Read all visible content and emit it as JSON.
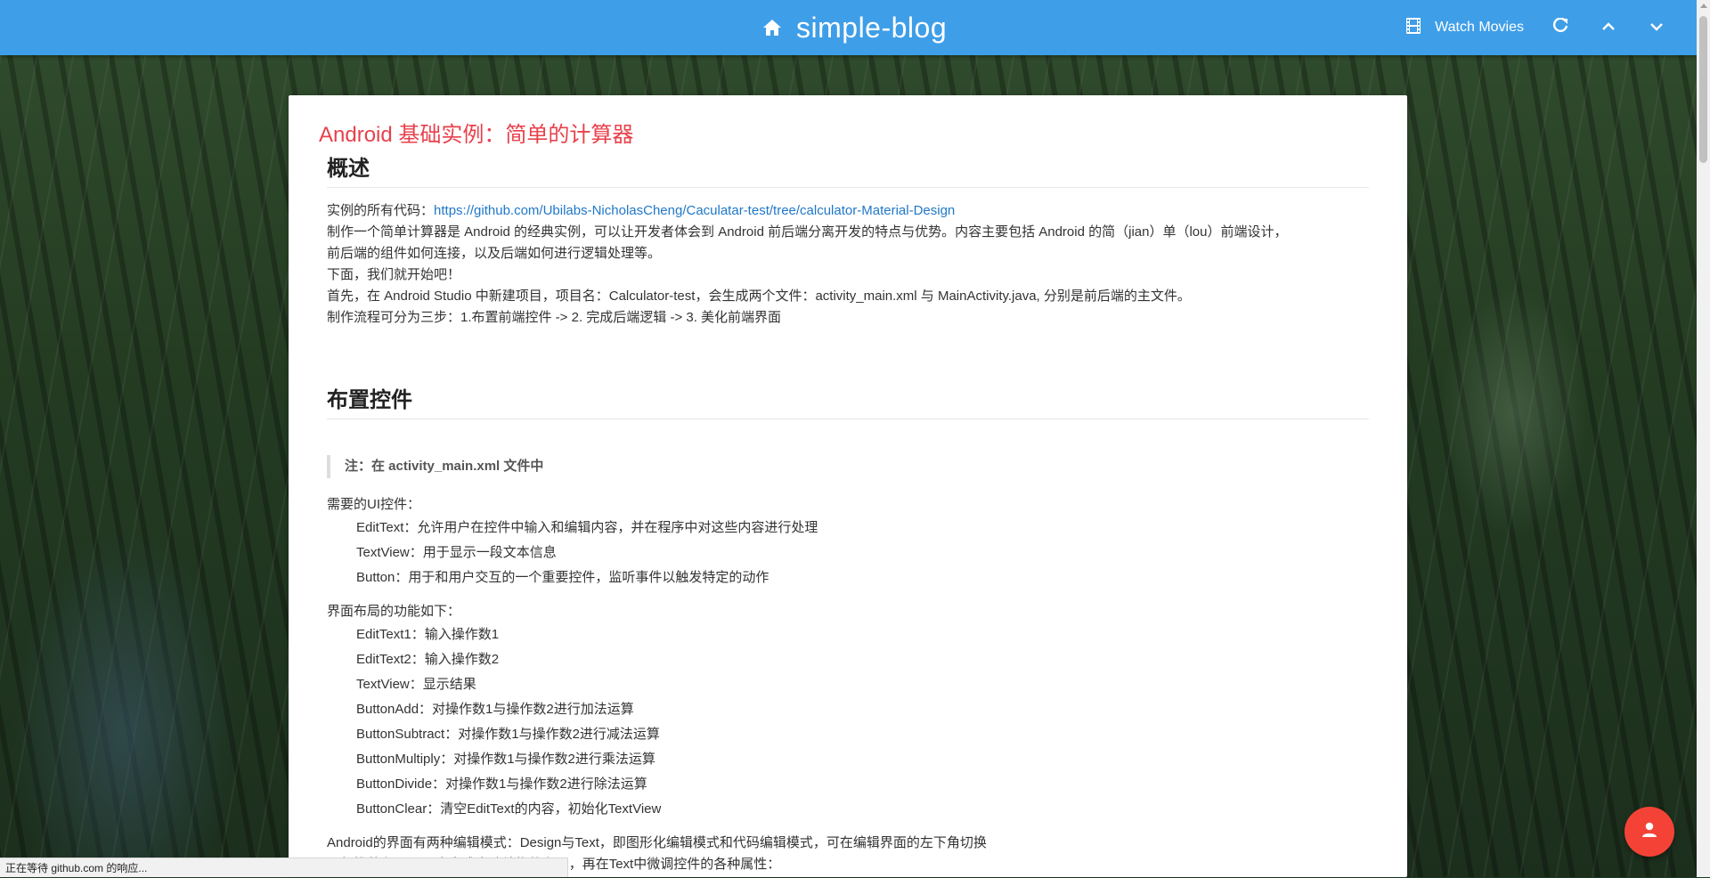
{
  "header": {
    "title": "simple-blog",
    "watch_movies_label": "Watch Movies",
    "accent_color": "#3f9ee8",
    "icons": [
      "home-icon",
      "film-icon",
      "refresh-icon",
      "chevron-up-icon",
      "chevron-down-icon"
    ]
  },
  "post": {
    "title": "Android 基础实例：简单的计算器",
    "sections": {
      "overview": {
        "heading": "概述",
        "code_prefix": "实例的所有代码：",
        "code_link": "https://github.com/Ubilabs-NicholasCheng/Caculatar-test/tree/calculator-Material-Design",
        "lines": [
          "制作一个简单计算器是 Android 的经典实例，可以让开发者体会到 Android 前后端分离开发的特点与优势。内容主要包括 Android 的简（jian）单（lou）前端设计，",
          "前后端的组件如何连接，以及后端如何进行逻辑处理等。",
          "下面，我们就开始吧！",
          "首先，在 Android Studio 中新建项目，项目名：Calculator-test，会生成两个文件：activity_main.xml 与 MainActivity.java, 分别是前后端的主文件。",
          "制作流程可分为三步：1.布置前端控件 -> 2. 完成后端逻辑 -> 3. 美化前端界面"
        ]
      },
      "layout": {
        "heading": "布置控件",
        "note": "注：在 activity_main.xml 文件中",
        "ui_title": "需要的UI控件：",
        "ui_items": [
          "EditText：允许用户在控件中输入和编辑内容，并在程序中对这些内容进行处理",
          "TextView：用于显示一段文本信息",
          "Button：用于和用户交互的一个重要控件，监听事件以触发特定的动作"
        ],
        "func_title": "界面布局的功能如下：",
        "func_items": [
          "EditText1：输入操作数1",
          "EditText2：输入操作数2",
          "TextView：显示结果",
          "ButtonAdd：对操作数1与操作数2进行加法运算",
          "ButtonSubtract：对操作数1与操作数2进行减法运算",
          "ButtonMultiply：对操作数1与操作数2进行乘法运算",
          "ButtonDivide：对操作数1与操作数2进行除法运算",
          "ButtonClear：清空EditText的内容，初始化TextView"
        ],
        "mode_lines": [
          "Android的界面有两种编辑模式：Design与Text，即图形化编辑模式和代码编辑模式，可在编辑界面的左下角切换",
          "一般推荐在Design中完成大致结构的布置，再在Text中微调控件的各种属性："
        ]
      }
    }
  },
  "status_bar": {
    "text": "正在等待 github.com 的响应..."
  },
  "fab": {
    "icon": "person-icon",
    "color": "#f44336"
  }
}
